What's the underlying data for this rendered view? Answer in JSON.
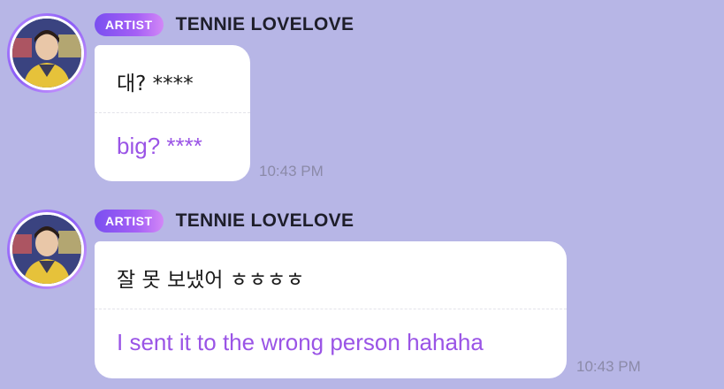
{
  "messages": [
    {
      "badge": "ARTIST",
      "sender": "TENNIE LOVELOVE",
      "original_text": "대? ****",
      "translated_text": "big? ****",
      "time": "10:43 PM"
    },
    {
      "badge": "ARTIST",
      "sender": "TENNIE LOVELOVE",
      "original_text": "잘 못 보냈어 ㅎㅎㅎㅎ",
      "translated_text": "I sent it to the wrong person hahaha",
      "time": "10:43 PM"
    }
  ],
  "colors": {
    "background": "#b7b6e6",
    "badge_gradient_start": "#7a4ff0",
    "badge_gradient_end": "#d287f7",
    "translation_text": "#9a54e6",
    "timestamp": "#8b8aa8",
    "bubble": "#ffffff"
  }
}
